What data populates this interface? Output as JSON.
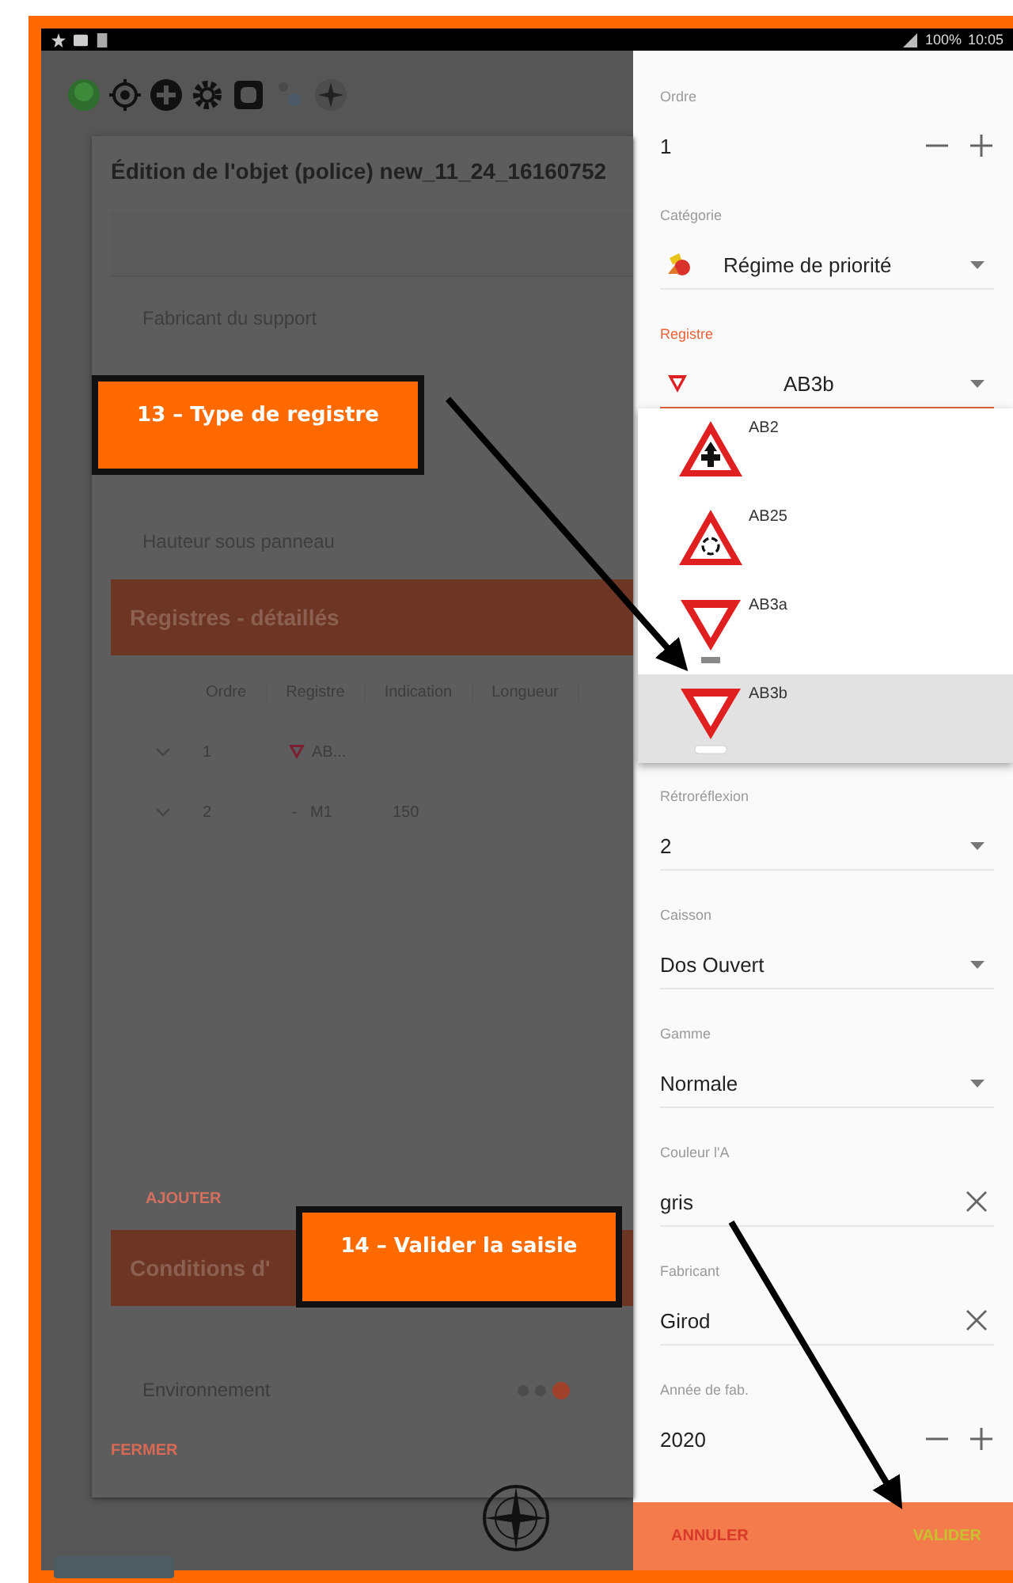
{
  "status_bar": {
    "battery": "100%",
    "time": "10:05"
  },
  "dialog": {
    "title": "Édition de l'objet (police) new_11_24_16160752",
    "fields": [
      "Fabricant du support",
      "Hauteur sous panneau"
    ],
    "registres": {
      "header": "Registres - détaillés",
      "columns": [
        "Ordre",
        "Registre",
        "Indication",
        "Longueur"
      ],
      "rows": [
        {
          "ordre": "1",
          "kind": "sign",
          "registre": "AB..."
        },
        {
          "ordre": "2",
          "kind": "dash",
          "marker": "-",
          "registre": "M1",
          "indication": "150"
        }
      ],
      "add_button": "AJOUTER"
    },
    "conditions": {
      "header": "Conditions d'"
    },
    "environment": {
      "label": "Environnement",
      "dots": [
        {
          "selected": false
        },
        {
          "selected": false
        },
        {
          "selected": true
        }
      ]
    },
    "close_button": "FERMER"
  },
  "form": {
    "fields": [
      {
        "kind": "stepper",
        "label": "Ordre",
        "value": "1"
      },
      {
        "kind": "select",
        "label": "Catégorie",
        "value": "Régime de priorité"
      },
      {
        "kind": "select",
        "label": "Registre",
        "value": "AB3b",
        "focused": true,
        "expanded": true,
        "options": [
          {
            "kind": "priority",
            "label": "AB2",
            "selected": false
          },
          {
            "kind": "roundabout",
            "label": "AB25",
            "selected": false
          },
          {
            "kind": "yield_plate",
            "label": "AB3a",
            "selected": false
          },
          {
            "kind": "yield_panel",
            "label": "AB3b",
            "selected": true
          }
        ]
      },
      {
        "kind": "select",
        "label": "Rétroréflexion",
        "value": "2"
      },
      {
        "kind": "select",
        "label": "Caisson",
        "value": "Dos Ouvert"
      },
      {
        "kind": "select",
        "label": "Gamme",
        "value": "Normale"
      },
      {
        "kind": "clearable",
        "label": "Couleur l'A",
        "value": "gris"
      },
      {
        "kind": "clearable",
        "label": "Fabricant",
        "value": "Girod"
      },
      {
        "kind": "stepper",
        "label": "Année de fab.",
        "value": "2020"
      }
    ],
    "buttons": [
      {
        "kind": "cancel",
        "label": "ANNULER"
      },
      {
        "kind": "confirm",
        "label": "VALIDER"
      }
    ]
  },
  "annotations": [
    {
      "text": "13 – Type de registre"
    },
    {
      "text": "14 – Valider la saisie"
    }
  ]
}
